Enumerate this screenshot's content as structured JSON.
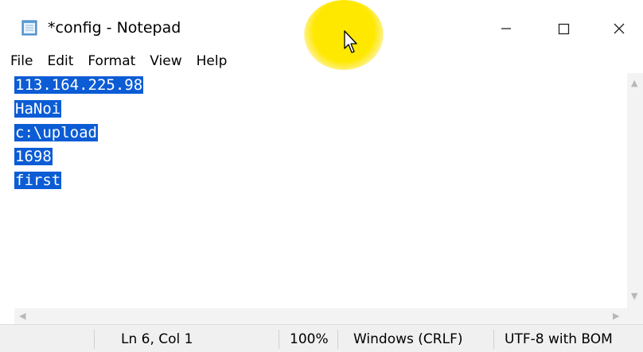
{
  "window": {
    "title": "*config - Notepad"
  },
  "menu": [
    "File",
    "Edit",
    "Format",
    "View",
    "Help"
  ],
  "editor": {
    "lines": [
      "113.164.225.98",
      "HaNoi",
      "c:\\upload",
      "1698",
      "first"
    ]
  },
  "status": {
    "position": "Ln 6, Col 1",
    "zoom": "100%",
    "line_ending": "Windows (CRLF)",
    "encoding": "UTF-8 with BOM"
  },
  "colors": {
    "selection": "#0b5cd5",
    "cursor_highlight": "#ffe800"
  },
  "icons": [
    "notepad-icon",
    "minimize-icon",
    "maximize-icon",
    "close-icon",
    "mouse-pointer-icon"
  ]
}
